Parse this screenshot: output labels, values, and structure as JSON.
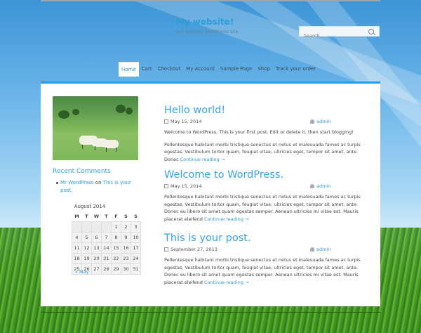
{
  "site": {
    "title": "My website!",
    "tagline": "Just another WordPress site"
  },
  "search": {
    "placeholder": "Search"
  },
  "nav": {
    "items": [
      "Home",
      "Cart",
      "Checkout",
      "My Account",
      "Sample Page",
      "Shop",
      "Track your order"
    ],
    "active": "Home"
  },
  "sidebar": {
    "recent_comments_title": "Recent Comments",
    "comment": {
      "author": "Mr WordPress",
      "on": "on",
      "link": "This is your post."
    },
    "calendar": {
      "title": "August 2014",
      "weekdays": [
        "M",
        "T",
        "W",
        "T",
        "F",
        "S",
        "S"
      ],
      "weeks": [
        [
          "",
          "",
          "",
          "",
          "1",
          "2",
          "3"
        ],
        [
          "4",
          "5",
          "6",
          "7",
          "8",
          "9",
          "10"
        ],
        [
          "11",
          "12",
          "13",
          "14",
          "15",
          "16",
          "17"
        ],
        [
          "18",
          "19",
          "20",
          "21",
          "22",
          "23",
          "24"
        ],
        [
          "25",
          "26",
          "27",
          "28",
          "29",
          "30",
          "31"
        ]
      ],
      "prev_link": "« May"
    }
  },
  "posts": [
    {
      "title": "Hello world!",
      "date": "May 15, 2014",
      "author": "admin",
      "paragraphs": [
        "Welcome to WordPress. This is your first post. Edit or delete it, then start blogging!",
        "Pellentesque habitant morbi tristique senectus et netus et malesuada fames ac turpis egestas. Vestibulum tortor quam, feugiat vitae, ultricies eget, tempor sit amet, ante. Donec"
      ],
      "continue": "Continue reading →"
    },
    {
      "title": "Welcome to WordPress.",
      "date": "May 15, 2014",
      "author": "admin",
      "paragraphs": [
        "Pellentesque habitant morbi tristique senectus et netus et malesuada fames ac turpis egestas. Vestibulum tortor quam, feugiat vitae, ultricies eget, tempor sit amet, ante. Donec eu libero sit amet quam egestas semper. Aenean ultricies mi vitae est. Mauris placerat eleifend"
      ],
      "continue": "Continue reading →"
    },
    {
      "title": "This is your post.",
      "date": "September 27, 2013",
      "author": "admin",
      "paragraphs": [
        "Pellentesque habitant morbi tristique senectus et netus et malesuada fames ac turpis egestas. Vestibulum tortor quam, feugiat vitae, ultricies eget, tempor sit amet, ante. Donec eu libero sit amet quam egestas semper. Aenean ultricies mi vitae est. Mauris placerat eleifend"
      ],
      "continue": "Continue reading →"
    }
  ],
  "colors": {
    "accent": "#2f9bd7",
    "link": "#3aa3e0"
  }
}
